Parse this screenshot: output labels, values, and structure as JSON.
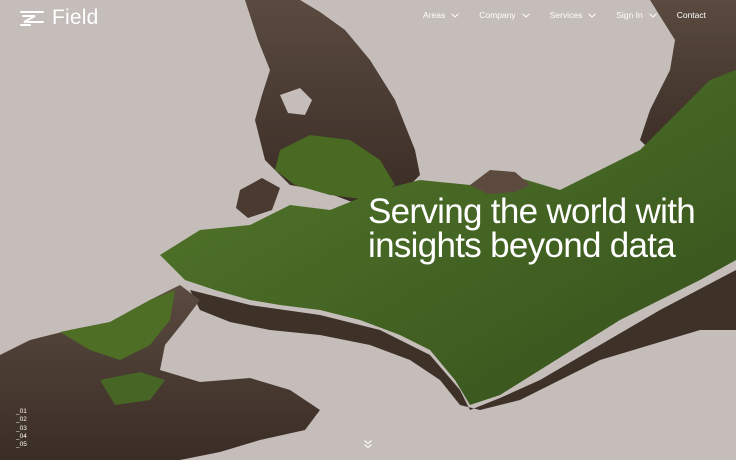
{
  "brand": {
    "name": "Field",
    "logo_icon": "field-logo-icon"
  },
  "nav": {
    "items": [
      {
        "label": "Areas",
        "has_dropdown": true
      },
      {
        "label": "Company",
        "has_dropdown": true
      },
      {
        "label": "Services",
        "has_dropdown": true
      },
      {
        "label": "Sign In",
        "has_dropdown": true
      },
      {
        "label": "Contact",
        "has_dropdown": false
      }
    ]
  },
  "hero": {
    "headline_line_1": "Serving the world with",
    "headline_line_2": "insights beyond data"
  },
  "slides": [
    "_01",
    "_02",
    "_03",
    "_04",
    "_05"
  ],
  "scroll_icon": "double-chevron-down-icon",
  "colors": {
    "background": "#c4bdba",
    "text": "#ffffff",
    "moss": "#4e6a2a",
    "rock": "#4a3a30"
  }
}
